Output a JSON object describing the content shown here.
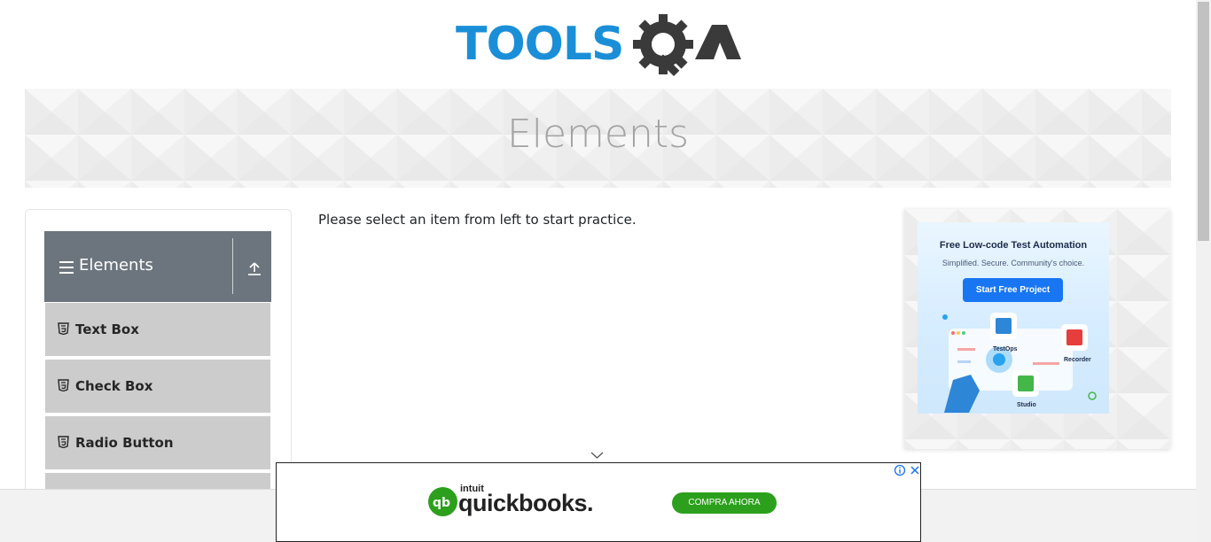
{
  "header": {
    "logo_text_left": "TOOLS",
    "logo_text_right": "QA"
  },
  "banner": {
    "title": "Elements"
  },
  "sidebar": {
    "group_title": "Elements",
    "items": [
      {
        "label": "Text Box"
      },
      {
        "label": "Check Box"
      },
      {
        "label": "Radio Button"
      }
    ]
  },
  "main": {
    "instruction": "Please select an item from left to start practice."
  },
  "side_ad": {
    "title": "Free Low-code Test Automation",
    "subtitle": "Simplified. Secure. Community's choice.",
    "cta": "Start Free Project",
    "labels": [
      "TestOps",
      "Recorder",
      "Studio"
    ]
  },
  "bottom_ad": {
    "brand_small": "intuit",
    "brand": "quickbooks.",
    "cta": "COMPRA AHORA"
  },
  "colors": {
    "logo_blue": "#1a8fd8",
    "logo_dark": "#3a3a3a",
    "sidebar_header": "#6c757d",
    "menu_item_bg": "#cccccc",
    "qb_green": "#2ca01c",
    "ad_cta_blue": "#1876f2"
  }
}
